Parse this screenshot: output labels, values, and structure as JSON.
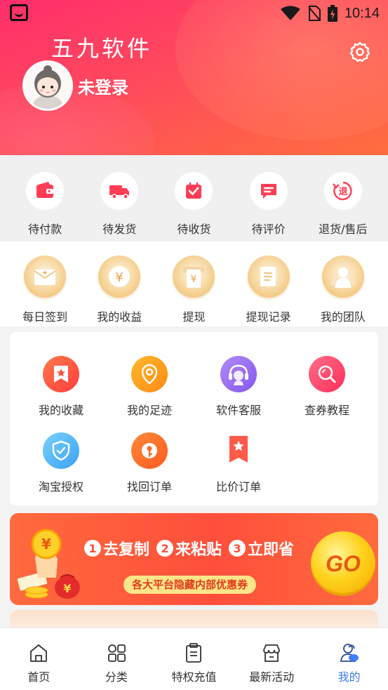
{
  "status_bar": {
    "time": "10:14"
  },
  "profile": {
    "app_title": "五九软件",
    "login_status": "未登录"
  },
  "order_row": [
    {
      "label": "待付款",
      "icon": "wallet-icon"
    },
    {
      "label": "待发货",
      "icon": "truck-icon"
    },
    {
      "label": "待收货",
      "icon": "package-check-icon"
    },
    {
      "label": "待评价",
      "icon": "review-icon"
    },
    {
      "label": "退货/售后",
      "icon": "refund-icon",
      "icon_text": "退"
    }
  ],
  "finance_row": [
    {
      "label": "每日签到",
      "icon": "envelope-icon"
    },
    {
      "label": "我的收益",
      "icon": "coin-icon",
      "icon_text": "¥"
    },
    {
      "label": "提现",
      "icon": "withdraw-icon",
      "icon_text": "¥"
    },
    {
      "label": "提现记录",
      "icon": "records-icon"
    },
    {
      "label": "我的团队",
      "icon": "team-icon"
    }
  ],
  "tools": [
    {
      "label": "我的收藏",
      "icon": "bookmark-star-icon",
      "color": "#ff5a3c"
    },
    {
      "label": "我的足迹",
      "icon": "location-pin-icon",
      "color": "#ff9a1f"
    },
    {
      "label": "软件客服",
      "icon": "customer-service-icon",
      "color": "#9b6cf2"
    },
    {
      "label": "查券教程",
      "icon": "magnifier-icon",
      "color": "#ff3d6a"
    },
    {
      "label": "淘宝授权",
      "icon": "shield-check-icon",
      "color": "#4fb3f6"
    },
    {
      "label": "找回订单",
      "icon": "key-icon",
      "color": "#ff6a2a"
    },
    {
      "label": "比价订单",
      "icon": "ribbon-star-icon",
      "color": "#ff5a4a"
    }
  ],
  "banner": {
    "step1_num": "1",
    "step1": "去复制",
    "step2_num": "2",
    "step2": "来粘贴",
    "step3_num": "3",
    "step3": "立即省",
    "subtitle": "各大平台隐藏内部优惠券",
    "go_label": "GO"
  },
  "bottom_nav": [
    {
      "label": "首页",
      "icon": "home-icon",
      "active": false
    },
    {
      "label": "分类",
      "icon": "category-grid-icon",
      "active": false
    },
    {
      "label": "特权充值",
      "icon": "clipboard-icon",
      "active": false
    },
    {
      "label": "最新活动",
      "icon": "store-icon",
      "active": false
    },
    {
      "label": "我的",
      "icon": "profile-icon",
      "active": true
    }
  ],
  "colors": {
    "header_gradient": [
      "#ff2e6b",
      "#ff6e3e"
    ],
    "accent": "#ff3d55",
    "active_nav": "#3d7ef5"
  }
}
